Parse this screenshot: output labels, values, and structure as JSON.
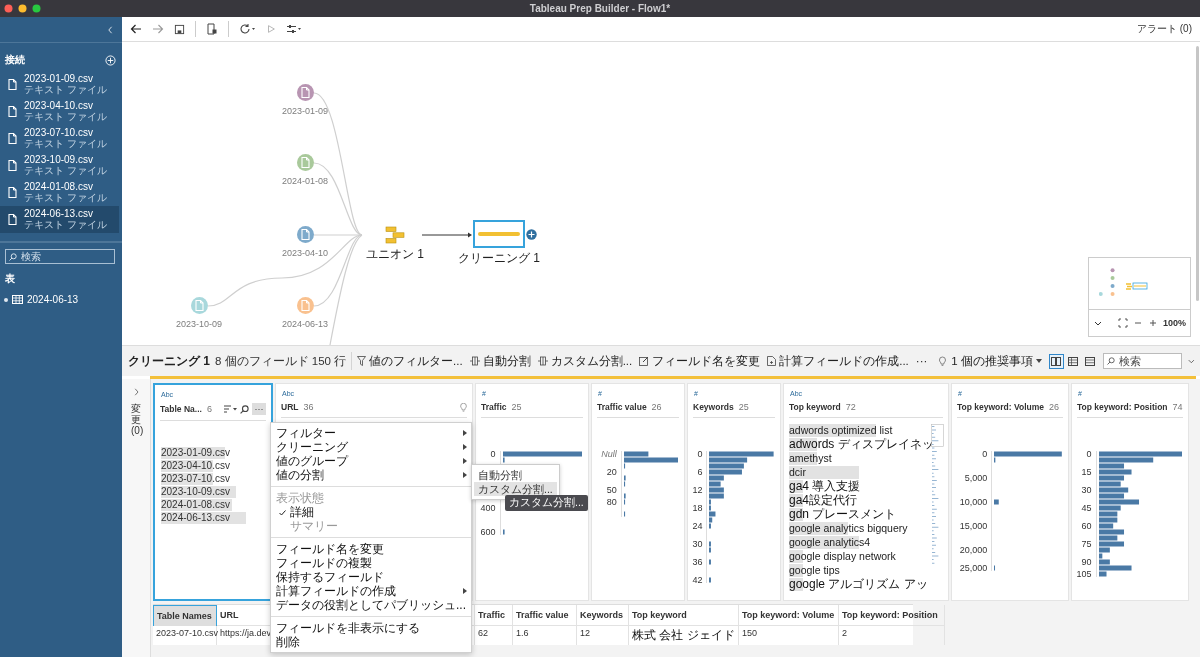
{
  "window": {
    "title": "Tableau Prep Builder - Flow1*"
  },
  "sidebar": {
    "connections": {
      "title": "接続",
      "files": [
        {
          "name": "2023-01-09.csv",
          "type": "テキスト ファイル",
          "selected": false
        },
        {
          "name": "2023-04-10.csv",
          "type": "テキスト ファイル",
          "selected": false
        },
        {
          "name": "2023-07-10.csv",
          "type": "テキスト ファイル",
          "selected": false
        },
        {
          "name": "2023-10-09.csv",
          "type": "テキスト ファイル",
          "selected": false
        },
        {
          "name": "2024-01-08.csv",
          "type": "テキスト ファイル",
          "selected": false
        },
        {
          "name": "2024-06-13.csv",
          "type": "テキスト ファイル",
          "selected": true
        }
      ]
    },
    "search": {
      "placeholder": "検索"
    },
    "tables": {
      "title": "表",
      "items": [
        {
          "name": "2024-06-13"
        }
      ]
    }
  },
  "toolbar": {
    "alerts": "アラート (0)"
  },
  "flow": {
    "nodes": [
      {
        "label": "2023-01-09",
        "color": "#b895b2"
      },
      {
        "label": "2024-01-08",
        "color": "#a9c99b"
      },
      {
        "label": "2023-04-10",
        "color": "#7eaacb"
      },
      {
        "label": "2023-10-09",
        "color": "#a8d8dc"
      },
      {
        "label": "2024-06-13",
        "color": "#f9c18f"
      }
    ],
    "union": {
      "label": "ユニオン 1"
    },
    "clean": {
      "label": "クリーニング 1",
      "selected": true
    },
    "zoom": "100%"
  },
  "profile_bar": {
    "step": "クリーニング 1",
    "summary": "8 個のフィールド  150 行",
    "actions": [
      {
        "kind": "filter",
        "label": "値のフィルター..."
      },
      {
        "kind": "split",
        "label": "自動分割"
      },
      {
        "kind": "split",
        "label": "カスタム分割..."
      },
      {
        "kind": "rename",
        "label": "フィールド名を変更"
      },
      {
        "kind": "calc",
        "label": "計算フィールドの作成..."
      }
    ],
    "more": "···",
    "recommendations": "1 個の推奨事項",
    "views": [
      {
        "selected": true
      },
      {
        "selected": false
      },
      {
        "selected": false
      }
    ],
    "search": {
      "placeholder": "検索"
    }
  },
  "changes": "変更(0)",
  "cards": [
    {
      "type": "Abc",
      "name": "Table Na...",
      "count": "6",
      "selected": true,
      "tools": {
        "more": "···"
      },
      "kind": "text",
      "values": [
        {
          "label": "2023-01-09.csv",
          "level": 0.62
        },
        {
          "label": "2023-04-10.csv",
          "level": 0.5
        },
        {
          "label": "2023-07-10.csv",
          "level": 0.5
        },
        {
          "label": "2023-10-09.csv",
          "level": 0.72
        },
        {
          "label": "2024-01-08.csv",
          "level": 0.68
        },
        {
          "label": "2024-06-13.csv",
          "level": 0.82
        }
      ]
    },
    {
      "type": "Abc",
      "name": "URL",
      "count": "36",
      "selected": false,
      "recommendation": true,
      "kind": "covered"
    },
    {
      "type": "#",
      "name": "Traffic",
      "count": "25",
      "selected": false,
      "kind": "numeric",
      "axis_labels": [
        {
          "label": "0",
          "kind": "value"
        },
        {
          "label": "400",
          "kind": "value"
        },
        {
          "label": "600",
          "kind": "value"
        }
      ]
    },
    {
      "type": "#",
      "name": "Traffic value",
      "count": "26",
      "selected": false,
      "kind": "numeric",
      "axis_labels": [
        {
          "label": "Null",
          "kind": "null"
        },
        {
          "label": "20",
          "kind": "value"
        },
        {
          "label": "50",
          "kind": "value"
        },
        {
          "label": "80",
          "kind": "value"
        }
      ]
    },
    {
      "type": "#",
      "name": "Keywords",
      "count": "25",
      "selected": false,
      "kind": "numeric",
      "axis_labels": [
        {
          "label": "0",
          "kind": "value"
        },
        {
          "label": "6",
          "kind": "value"
        },
        {
          "label": "12",
          "kind": "value"
        },
        {
          "label": "18",
          "kind": "value"
        },
        {
          "label": "24",
          "kind": "value"
        },
        {
          "label": "30",
          "kind": "value"
        },
        {
          "label": "36",
          "kind": "value"
        },
        {
          "label": "42",
          "kind": "value"
        }
      ]
    },
    {
      "type": "Abc",
      "name": "Top keyword",
      "count": "72",
      "selected": false,
      "kind": "text",
      "values": [
        {
          "label": "adwords optimized list",
          "level": 0.62
        },
        {
          "label": "adwords ディスプレイネッ",
          "level": 0.2
        },
        {
          "label": "amethyst",
          "level": 0.2
        },
        {
          "label": "dcir",
          "level": 0.5
        },
        {
          "label": "ga4 導入支援",
          "level": 0.1
        },
        {
          "label": "ga4設定代行",
          "level": 0.1
        },
        {
          "label": "gdn プレースメント",
          "level": 0.1
        },
        {
          "label": "google analytics bigquery",
          "level": 0.42
        },
        {
          "label": "google analytics4",
          "level": 0.5
        },
        {
          "label": "google display network",
          "level": 0.1
        },
        {
          "label": "google tips",
          "level": 0.1
        },
        {
          "label": "google アルゴリズム アッ",
          "level": 0.1
        }
      ]
    },
    {
      "type": "#",
      "name": "Top keyword: Volume",
      "count": "26",
      "selected": false,
      "kind": "numeric",
      "axis_labels": [
        {
          "label": "0",
          "kind": "value"
        },
        {
          "label": "5,000",
          "kind": "value"
        },
        {
          "label": "10,000",
          "kind": "value"
        },
        {
          "label": "15,000",
          "kind": "value"
        },
        {
          "label": "20,000",
          "kind": "value"
        },
        {
          "label": "25,000",
          "kind": "value"
        }
      ]
    },
    {
      "type": "#",
      "name": "Top keyword: Position",
      "count": "74",
      "selected": false,
      "kind": "numeric",
      "axis_labels": [
        {
          "label": "0",
          "kind": "value"
        },
        {
          "label": "15",
          "kind": "value"
        },
        {
          "label": "30",
          "kind": "value"
        },
        {
          "label": "45",
          "kind": "value"
        },
        {
          "label": "60",
          "kind": "value"
        },
        {
          "label": "75",
          "kind": "value"
        },
        {
          "label": "90",
          "kind": "value"
        },
        {
          "label": "105",
          "kind": "value"
        }
      ]
    }
  ],
  "table": {
    "columns": [
      {
        "label": "Table Names",
        "selected": true
      },
      {
        "label": "URL",
        "selected": false
      },
      {
        "label": "Traffic",
        "selected": false
      },
      {
        "label": "Traffic value",
        "selected": false
      },
      {
        "label": "Keywords",
        "selected": false
      },
      {
        "label": "Top keyword",
        "selected": false
      },
      {
        "label": "Top keyword: Volume",
        "selected": false
      },
      {
        "label": "Top keyword: Position",
        "selected": false
      }
    ],
    "rows": [
      [
        "2023-07-10.csv",
        "https://ja.dev",
        "62",
        "1.6",
        "12",
        "株式 会社 ジェイド",
        "150",
        "2"
      ]
    ]
  },
  "menu": {
    "sections": [
      [
        {
          "kind": "item",
          "label": "フィルター",
          "submenu": true
        },
        {
          "kind": "item",
          "label": "クリーニング",
          "submenu": true
        },
        {
          "kind": "item",
          "label": "値のグループ",
          "submenu": true
        },
        {
          "kind": "item",
          "label": "値の分割",
          "submenu": true
        }
      ],
      [
        {
          "kind": "header",
          "label": "表示状態"
        },
        {
          "kind": "check",
          "label": "詳細",
          "checked": true,
          "disabled": false
        },
        {
          "kind": "check",
          "label": "サマリー",
          "checked": false,
          "disabled": true
        }
      ],
      [
        {
          "kind": "item",
          "label": "フィールド名を変更",
          "submenu": false
        },
        {
          "kind": "item",
          "label": "フィールドの複製",
          "submenu": false
        },
        {
          "kind": "item",
          "label": "保持するフィールド",
          "submenu": false
        },
        {
          "kind": "item",
          "label": "計算フィールドの作成",
          "submenu": true
        },
        {
          "kind": "item",
          "label": "データの役割としてパブリッシュ...",
          "submenu": false
        }
      ],
      [
        {
          "kind": "item",
          "label": "フィールドを非表示にする",
          "submenu": false
        },
        {
          "kind": "item",
          "label": "削除",
          "submenu": false
        }
      ]
    ],
    "submenu": [
      {
        "label": "自動分割",
        "selected": false
      },
      {
        "label": "カスタム分割...",
        "selected": true
      }
    ],
    "tooltip": "カスタム分割..."
  }
}
